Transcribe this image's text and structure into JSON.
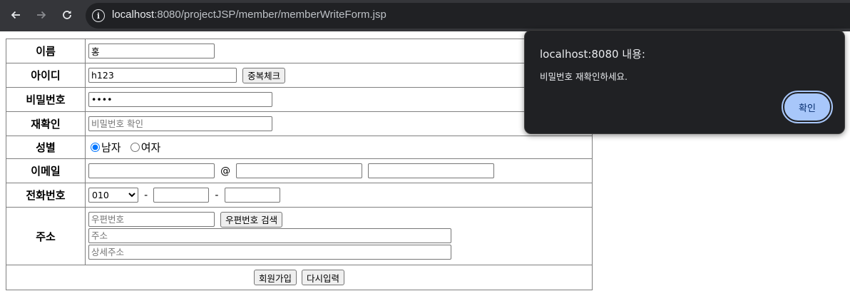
{
  "browser": {
    "url_host": "localhost",
    "url_path": ":8080/projectJSP/member/memberWriteForm.jsp"
  },
  "form": {
    "name_label": "이름",
    "name_value": "홍",
    "id_label": "아이디",
    "id_value": "h123",
    "dup_check_button": "중복체크",
    "pwd_label": "비밀번호",
    "pwd_value": "1234",
    "repwd_label": "재확인",
    "repwd_placeholder": "비밀번호 확인",
    "gender_label": "성별",
    "gender_male": "남자",
    "gender_female": "여자",
    "gender_selected": "남자",
    "email_label": "이메일",
    "email_at": "@",
    "phone_label": "전화번호",
    "phone_prefix": "010",
    "phone_dash": "-",
    "address_label": "주소",
    "zipcode_placeholder": "우편번호",
    "zipcode_search_button": "우편번호 검색",
    "address_placeholder": "주소",
    "address_detail_placeholder": "상세주소",
    "submit_button": "회원가입",
    "reset_button": "다시입력"
  },
  "dialog": {
    "title": "localhost:8080 내용:",
    "message": "비밀번호 재확인하세요.",
    "ok_button": "확인"
  },
  "colors": {
    "toolbar": "#35363a",
    "omnibox": "#202124",
    "dialog_bg": "#202124",
    "ok_button": "#a8c7fa"
  }
}
